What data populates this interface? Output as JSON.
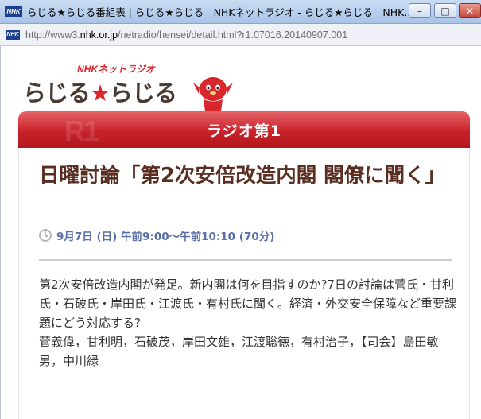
{
  "window": {
    "title": "らじる★らじる番組表 | らじる★らじる　NHKネットラジオ - らじる★らじる　NHK...",
    "favicon_label": "NHK",
    "minimize_label": "–",
    "maximize_label": "□",
    "close_label": "✕"
  },
  "address": {
    "url_prefix": "http://www3.",
    "url_host": "nhk.or.jp",
    "url_path": "/netradio/hensei/detail.html?r1.07016.20140907.001"
  },
  "logo": {
    "small_text": "NHKネットラジオ",
    "main_left": "らじる",
    "star": "★",
    "main_right": "らじる"
  },
  "banner": {
    "label": "ラジオ第1",
    "deco": "R1"
  },
  "program": {
    "title": "日曜討論「第2次安倍改造内閣 閣僚に聞く」",
    "schedule": "9月7日 (日) 午前9:00～午前10:10 (70分)",
    "description": "第2次安倍改造内閣が発足。新内閣は何を目指すのか?7日の討論は菅氏・甘利氏・石破氏・岸田氏・江渡氏・有村氏に聞く。経済・外交安全保障など重要課題にどう対応する?",
    "cast": "菅義偉，甘利明，石破茂，岸田文雄，江渡聡徳，有村治子，【司会】島田敏男，中川緑"
  },
  "colors": {
    "banner_red": "#c9232a",
    "title_brown": "#5a2e21",
    "schedule_blue": "#5a6fa8",
    "logo_red": "#d8262d"
  }
}
